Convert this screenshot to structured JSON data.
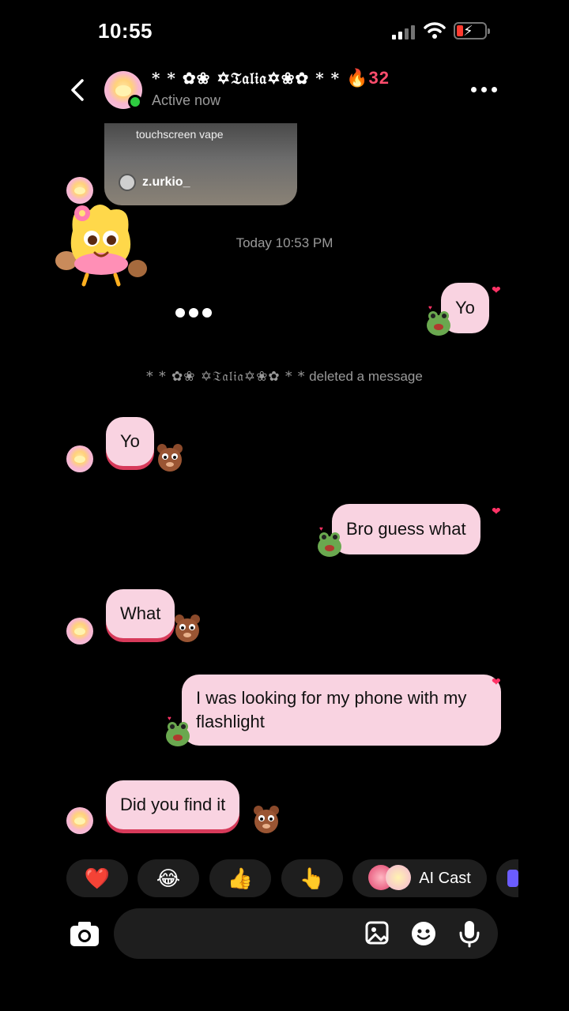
{
  "status": {
    "time": "10:55"
  },
  "header": {
    "contact_name": "* * ✿❀ ✡𝔗𝔞𝔩𝔦𝔞✡❀✿ * *",
    "streak": "🔥32",
    "status": "Active now"
  },
  "shared_post": {
    "caption": "touchscreen vape",
    "username": "z.urkio_"
  },
  "timestamp": "Today 10:53 PM",
  "deleted_notice": {
    "name": "* * ✿❀ ✡𝔗𝔞𝔩𝔦𝔞✡❀✿ * *",
    "text": "deleted a message"
  },
  "messages": [
    {
      "side": "out",
      "text": "Yo"
    },
    {
      "side": "in",
      "text": "Yo"
    },
    {
      "side": "out",
      "text": "Bro guess what"
    },
    {
      "side": "in",
      "text": "What"
    },
    {
      "side": "out",
      "text": "I was looking for my phone with my flashlight"
    },
    {
      "side": "in",
      "text": "Did you find it"
    }
  ],
  "quick_reactions": [
    {
      "emoji": "❤️"
    },
    {
      "emoji": "😂"
    },
    {
      "emoji": "👍"
    },
    {
      "emoji": "👆"
    }
  ],
  "ai_cast": {
    "label": "AI Cast"
  },
  "composer": {
    "placeholder": ""
  },
  "colors": {
    "bubble": "#f9d3e1",
    "incoming_accent": "#d73a5a",
    "online": "#2ecc40",
    "streak": "#ff4d6d"
  },
  "icons": [
    "back-chevron-icon",
    "more-dots-icon",
    "camera-icon",
    "gallery-icon",
    "sticker-icon",
    "microphone-icon"
  ]
}
